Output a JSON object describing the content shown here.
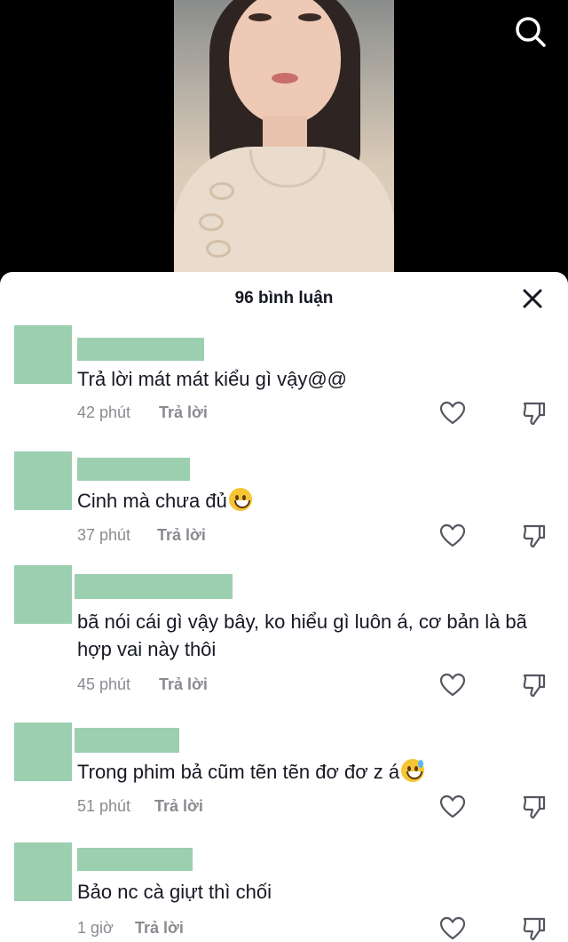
{
  "header": {
    "title": "96 bình luận"
  },
  "icons": {
    "search": "search-icon",
    "close": "close-icon",
    "like": "heart-outline-icon",
    "dislike": "thumbs-down-icon"
  },
  "comments": [
    {
      "text": "Trả lời mát mát kiểu gì vậy@@",
      "emoji": "",
      "time": "42 phút",
      "reply": "Trả lời"
    },
    {
      "text": "Cinh mà chưa đủ",
      "emoji": "grinning-face",
      "time": "37 phút",
      "reply": "Trả lời"
    },
    {
      "text": "bã nói cái gì vậy bây, ko hiểu gì luôn á, cơ bản là bã hợp vai này thôi",
      "emoji": "",
      "time": "45 phút",
      "reply": "Trả lời"
    },
    {
      "text": "Trong phim bả cũm tẽn tẽn đơ đơ z á",
      "emoji": "grinning-face-with-sweat",
      "time": "51 phút",
      "reply": "Trả lời"
    },
    {
      "text": "Bảo nc cà giựt thì chối",
      "emoji": "",
      "time": "1 giờ",
      "reply": "Trả lời"
    }
  ]
}
